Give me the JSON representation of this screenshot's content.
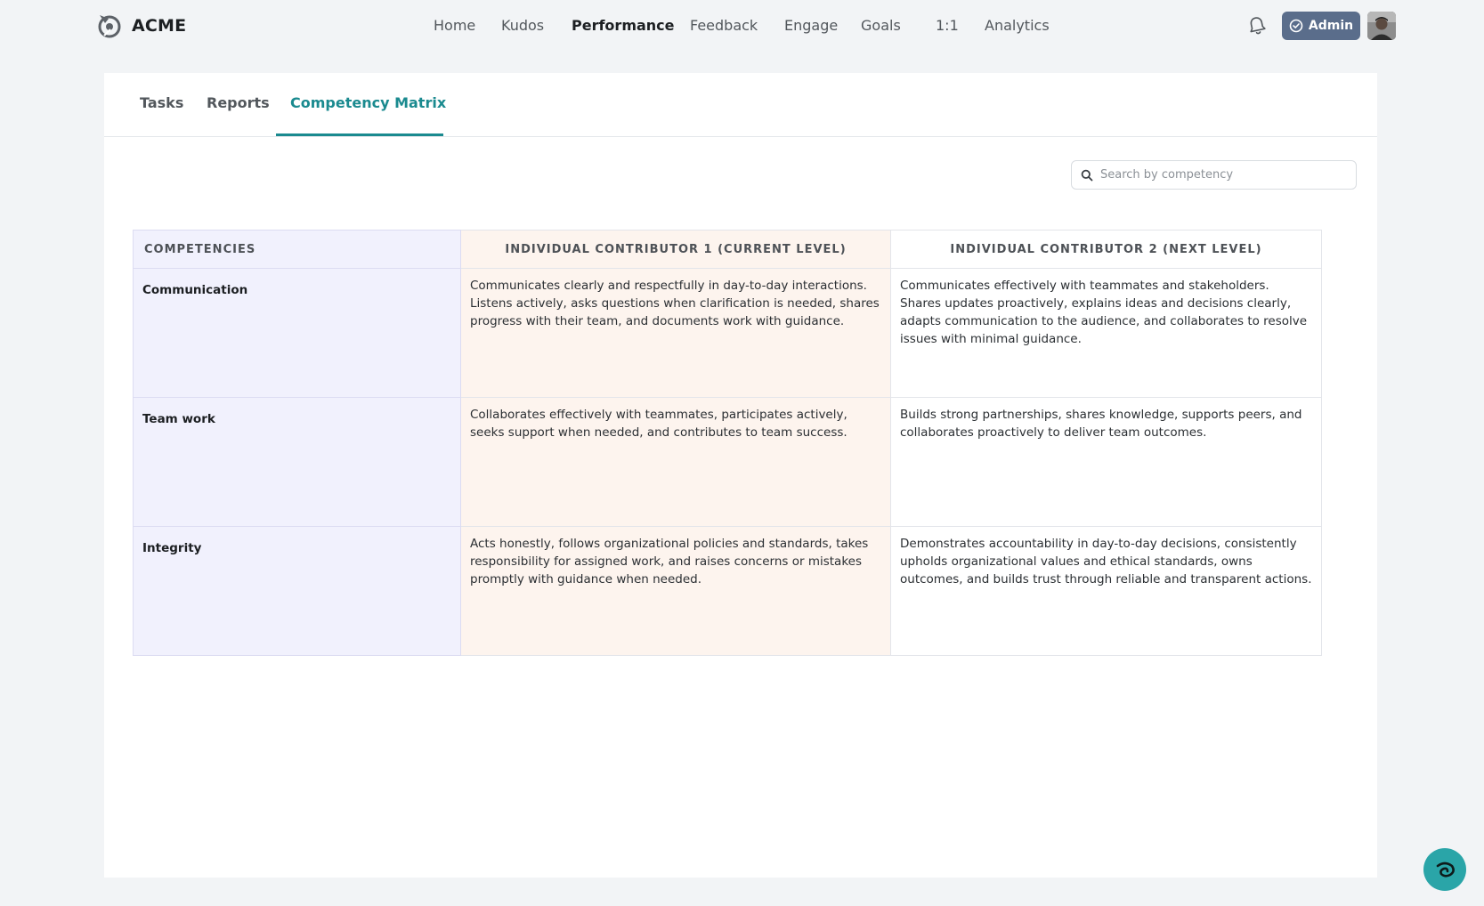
{
  "brand": {
    "name": "ACME"
  },
  "nav": {
    "items": [
      {
        "label": "Home",
        "active": false
      },
      {
        "label": "Kudos",
        "active": false
      },
      {
        "label": "Performance",
        "active": true
      },
      {
        "label": "Feedback",
        "active": false
      },
      {
        "label": "Engage",
        "active": false
      },
      {
        "label": "Goals",
        "active": false
      },
      {
        "label": "1:1",
        "active": false
      },
      {
        "label": "Analytics",
        "active": false
      }
    ]
  },
  "header": {
    "admin_label": "Admin"
  },
  "tabs": [
    {
      "label": "Tasks",
      "active": false
    },
    {
      "label": "Reports",
      "active": false
    },
    {
      "label": "Competency Matrix",
      "active": true
    }
  ],
  "search": {
    "placeholder": "Search by competency",
    "value": ""
  },
  "matrix": {
    "headers": {
      "competencies": "COMPETENCIES",
      "current": "INDIVIDUAL CONTRIBUTOR 1 (CURRENT LEVEL)",
      "next": "INDIVIDUAL CONTRIBUTOR 2 (NEXT LEVEL)"
    },
    "rows": [
      {
        "competency": "Communication",
        "current": "Communicates clearly and respectfully in day-to-day interactions. Listens actively, asks questions when clarification is needed, shares progress with their team, and documents work with guidance.",
        "next": "Communicates effectively with teammates and stakeholders. Shares updates proactively, explains ideas and decisions clearly, adapts communication to the audience, and collaborates to resolve issues with minimal guidance."
      },
      {
        "competency": "Team work",
        "current": "Collaborates effectively with teammates, participates actively, seeks support when needed, and contributes to team success.",
        "next": "Builds strong partnerships, shares knowledge, supports peers, and collaborates proactively to deliver team outcomes."
      },
      {
        "competency": "Integrity",
        "current": "Acts honestly, follows organizational policies and standards, takes responsibility for assigned work, and raises concerns or mistakes promptly with guidance when needed.",
        "next": "Demonstrates accountability in day-to-day decisions, consistently upholds organizational values and ethical standards, owns outcomes, and builds trust through reliable and transparent actions."
      }
    ]
  },
  "colors": {
    "accent": "#1a8a8f",
    "admin_button": "#5a6d8b",
    "competency_column": "#f1f1fd",
    "current_level_column": "#fdf4ee",
    "help_button": "#2aa5a8"
  },
  "icons": {
    "logo": "acme-logo-icon",
    "notifications": "bell-icon",
    "admin": "admin-shield-icon",
    "search": "search-icon",
    "help": "help-chat-icon"
  }
}
